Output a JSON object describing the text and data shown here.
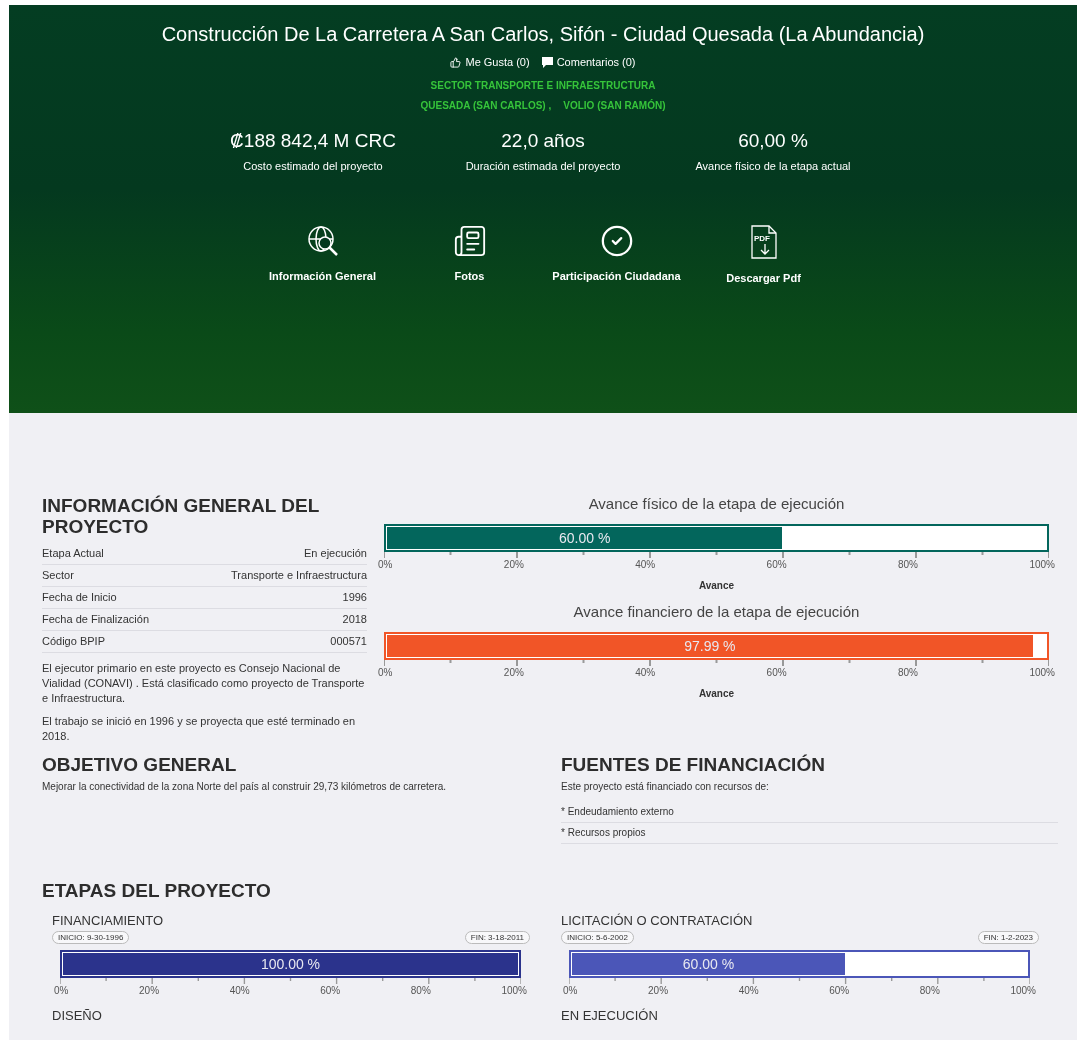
{
  "header": {
    "title": "Construcción De La Carretera A San Carlos, Sifón - Ciudad Quesada (La Abundancia)",
    "likes": "Me Gusta (0)",
    "comments": "Comentarios (0)",
    "sector": "SECTOR TRANSPORTE E INFRAESTRUCTURA",
    "locations": [
      "QUESADA (SAN CARLOS) ,",
      "VOLIO (SAN RAMÓN)"
    ],
    "stats": [
      {
        "value": "₡188 842,4 M CRC",
        "label": "Costo estimado del proyecto"
      },
      {
        "value": "22,0 años",
        "label": "Duración estimada del proyecto"
      },
      {
        "value": "60,00 %",
        "label": "Avance físico de la etapa actual"
      }
    ],
    "actions": [
      {
        "label": "Información General",
        "kind": "globe"
      },
      {
        "label": "Fotos",
        "kind": "news"
      },
      {
        "label": "Participación Ciudadana",
        "kind": "check"
      },
      {
        "label": "Descargar Pdf",
        "kind": "pdf",
        "icon_text": "PDF"
      }
    ]
  },
  "info": {
    "title": "INFORMACIÓN GENERAL DEL PROYECTO",
    "rows": [
      {
        "label": "Etapa Actual",
        "value": "En ejecución"
      },
      {
        "label": "Sector",
        "value": "Transporte e Infraestructura"
      },
      {
        "label": "Fecha de Inicio",
        "value": "1996"
      },
      {
        "label": "Fecha de Finalización",
        "value": "2018"
      },
      {
        "label": "Código BPIP",
        "value": "000571"
      }
    ],
    "paragraphs": [
      "El ejecutor primario en este proyecto es Consejo Nacional de Vialidad (CONAVI) . Está clasificado como proyecto de Transporte e Infraestructura.",
      "El trabajo se inició en 1996 y se proyecta que esté terminado en 2018."
    ]
  },
  "progress": [
    {
      "title": "Avance físico de la etapa de ejecución",
      "label": "60.00 %",
      "level": 0.6,
      "color": "#03665c",
      "ticks": [
        "0%",
        "20%",
        "40%",
        "60%",
        "80%",
        "100%"
      ],
      "axis_label": "Avance"
    },
    {
      "title": "Avance financiero de la etapa de ejecución",
      "label": "97.99 %",
      "level": 0.9799,
      "color": "#f15527",
      "ticks": [
        "0%",
        "20%",
        "40%",
        "60%",
        "80%",
        "100%"
      ],
      "axis_label": "Avance"
    }
  ],
  "objective": {
    "title": "OBJETIVO GENERAL",
    "text": "Mejorar la conectividad de la zona Norte del país al construir 29,73 kilómetros de carretera."
  },
  "funding": {
    "title": "FUENTES DE FINANCIACIÓN",
    "intro": "Este proyecto está financiado con recursos de:",
    "items": [
      "* Endeudamiento externo",
      "* Recursos propios"
    ]
  },
  "stages": {
    "title": "ETAPAS DEL PROYECTO",
    "items": [
      {
        "name": "FINANCIAMIENTO",
        "start": "INICIO: 9-30-1996",
        "end": "FIN: 3-18-2011",
        "label": "100.00 %",
        "level": 1,
        "color": "#2b338c",
        "ticks": [
          "0%",
          "20%",
          "40%",
          "60%",
          "80%",
          "100%"
        ]
      },
      {
        "name": "LICITACIÓN O CONTRATACIÓN",
        "start": "INICIO: 5-6-2002",
        "end": "FIN: 1-2-2023",
        "label": "60.00 %",
        "level": 0.6,
        "color": "#4b56b8",
        "ticks": [
          "0%",
          "20%",
          "40%",
          "60%",
          "80%",
          "100%"
        ]
      },
      {
        "name": "DISEÑO"
      },
      {
        "name": "EN EJECUCIÓN"
      }
    ]
  }
}
